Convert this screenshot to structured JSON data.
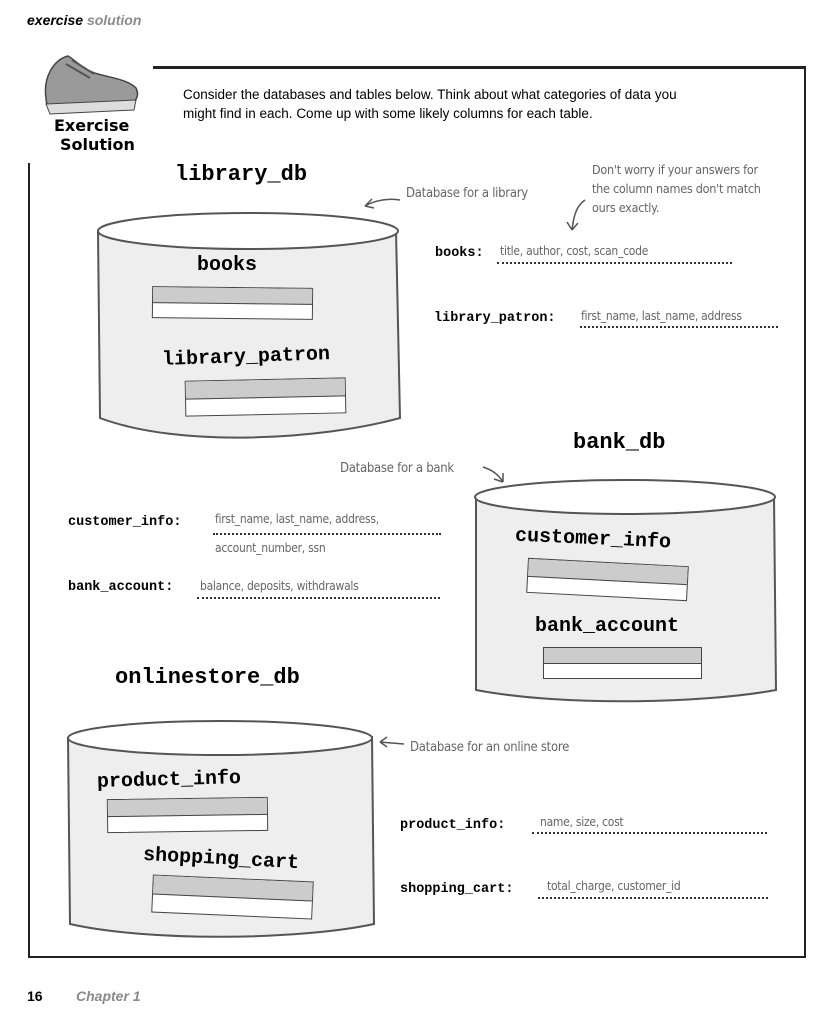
{
  "header": {
    "bold": "exercise",
    "gray": "solution"
  },
  "badge": {
    "line1": "Exercise",
    "line2": "Solution"
  },
  "intro": "Consider the databases and tables below. Think about what categories of data you might find in each. Come up with some likely columns for each table.",
  "note": "Don't worry if your answers for the column names don't match ours exactly.",
  "databases": [
    {
      "name": "library_db",
      "caption": "Database for a library",
      "tables": [
        "books",
        "library_patron"
      ],
      "answers": [
        {
          "label": "books:",
          "columns": "title, author, cost, scan_code"
        },
        {
          "label": "library_patron:",
          "columns": "first_name, last_name, address"
        }
      ]
    },
    {
      "name": "bank_db",
      "caption": "Database for a bank",
      "tables": [
        "customer_info",
        "bank_account"
      ],
      "answers": [
        {
          "label": "customer_info:",
          "columns": "first_name, last_name, address,",
          "columns2": "account_number, ssn"
        },
        {
          "label": "bank_account:",
          "columns": "balance, deposits, withdrawals"
        }
      ]
    },
    {
      "name": "onlinestore_db",
      "caption": "Database for an online store",
      "tables": [
        "product_info",
        "shopping_cart"
      ],
      "answers": [
        {
          "label": "product_info:",
          "columns": "name, size, cost"
        },
        {
          "label": "shopping_cart:",
          "columns": "total_charge, customer_id"
        }
      ]
    }
  ],
  "footer": {
    "page": "16",
    "chapter": "Chapter 1"
  }
}
